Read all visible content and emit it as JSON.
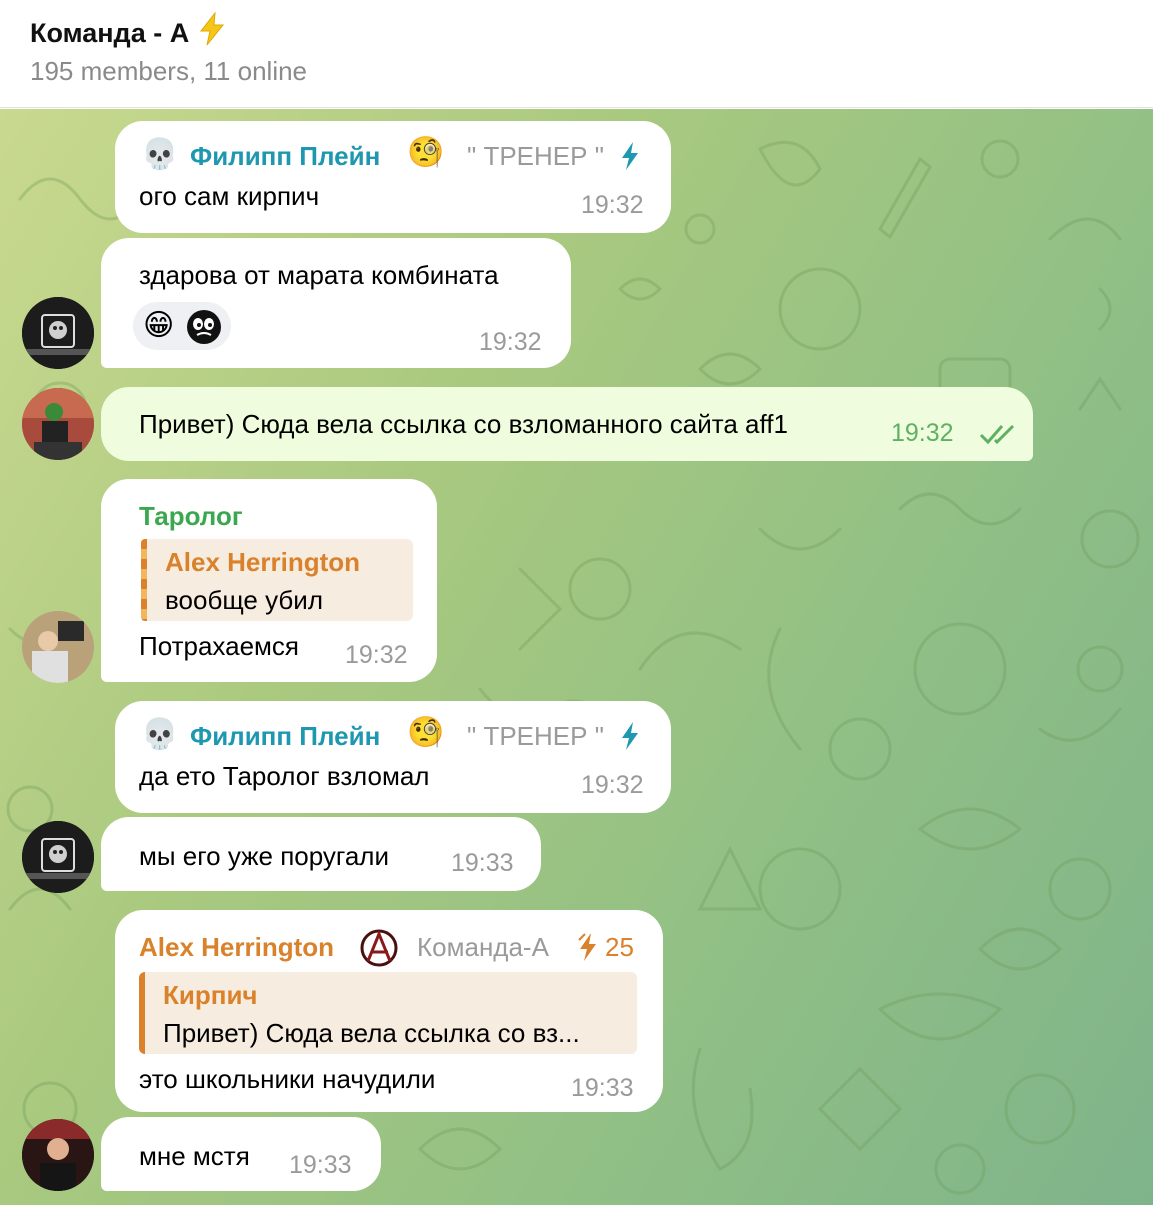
{
  "header": {
    "title": "Команда - А",
    "title_icon": "lightning-icon",
    "subtitle": "195 members, 11 online"
  },
  "messages": [
    {
      "sender": "Филипп Плейн",
      "badge": "\" ТРЕНЕР \"",
      "text": "ого сам кирпич",
      "time": "19:32"
    },
    {
      "text": "здарова от марата комбината",
      "time": "19:32",
      "reactions": [
        "😁",
        "reaction-sticker-icon"
      ]
    },
    {
      "text": "Привет) Сюда вела ссылка со взломанного сайта aff1",
      "time": "19:32",
      "outgoing": true
    },
    {
      "sender": "Таролог",
      "reply_author": "Alex Herrington",
      "reply_text": "вообще убил",
      "text": "Потрахаемся",
      "time": "19:32"
    },
    {
      "sender": "Филипп Плейн",
      "badge": "\" ТРЕНЕР \"",
      "text": "да ето Таролог взломал",
      "time": "19:32"
    },
    {
      "text": "мы его уже поругали",
      "time": "19:33"
    },
    {
      "sender": "Alex Herrington",
      "badge": "Команда-А",
      "boost": "25",
      "reply_author": "Кирпич",
      "reply_text": "Привет) Сюда вела ссылка со вз...",
      "text": "это школьники начудили",
      "time": "19:33"
    },
    {
      "text": "мне мстя",
      "time": "19:33"
    }
  ],
  "colors": {
    "accent_teal": "#1e98b0",
    "accent_green": "#3ba84f",
    "accent_orange": "#d9822b",
    "outgoing_bubble": "#effdde"
  }
}
